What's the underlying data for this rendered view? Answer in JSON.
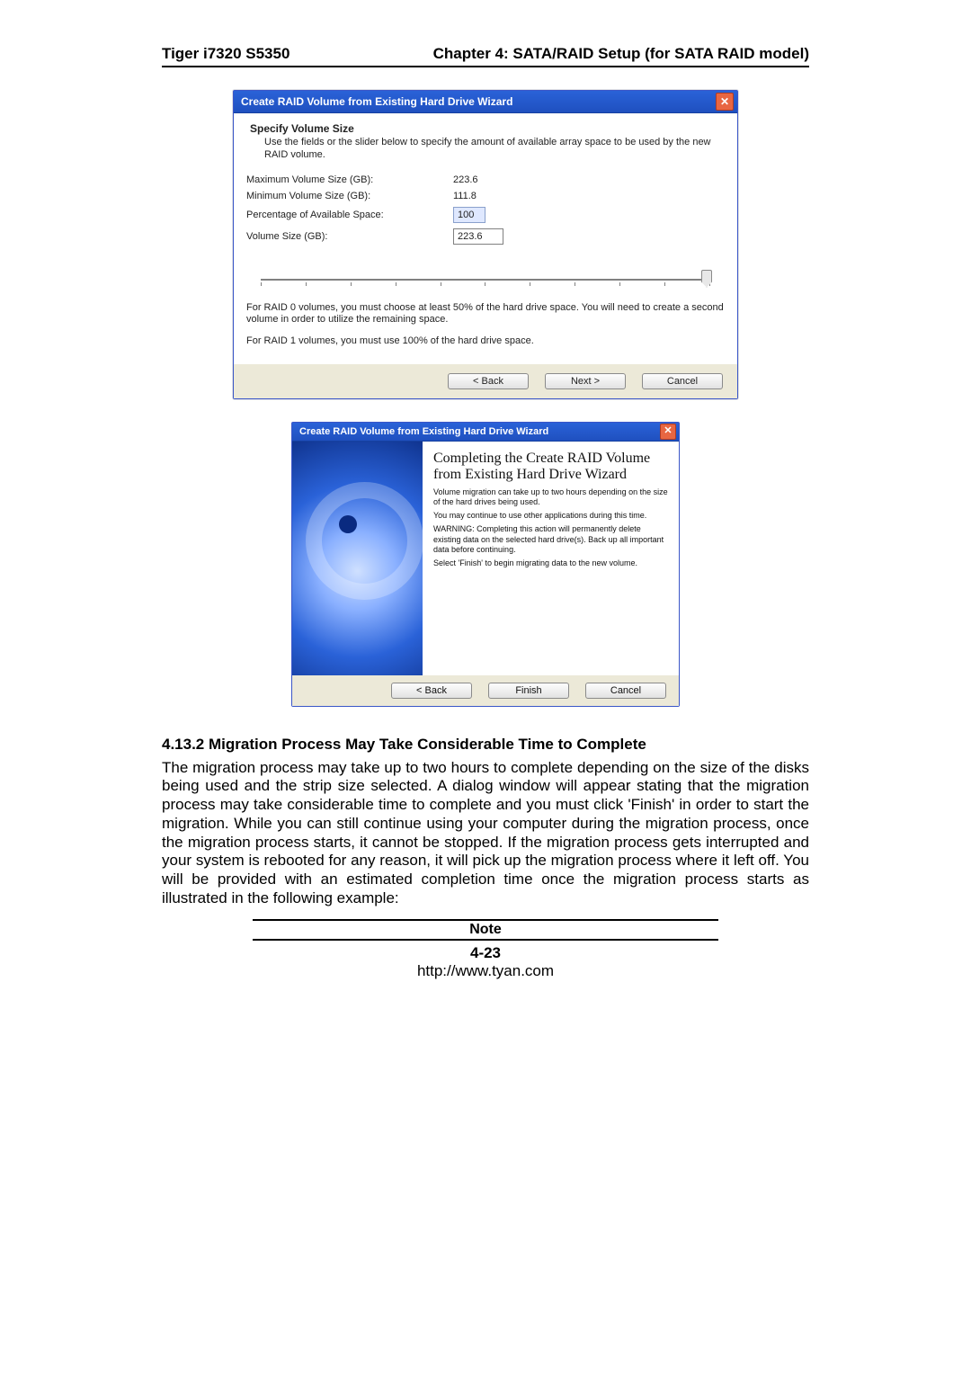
{
  "header": {
    "left": "Tiger i7320 S5350",
    "right": "Chapter 4: SATA/RAID Setup (for SATA RAID model)"
  },
  "dialog1": {
    "title": "Create RAID Volume from Existing Hard Drive Wizard",
    "subheader": "Specify Volume Size",
    "subdesc": "Use the fields or the slider below to specify the amount of available array space to be used by the new RAID volume.",
    "rows": {
      "maxLabel": "Maximum Volume Size (GB):",
      "maxValue": "223.6",
      "minLabel": "Minimum Volume Size (GB):",
      "minValue": "111.8",
      "pctLabel": "Percentage of Available Space:",
      "pctValue": "100",
      "sizeLabel": "Volume Size (GB):",
      "sizeValue": "223.6"
    },
    "note1": "For RAID 0 volumes, you must choose at least 50% of the hard drive space. You will need to create a second volume in order to utilize the remaining space.",
    "note2": "For RAID 1 volumes, you must use 100% of the hard drive space.",
    "buttons": {
      "back": "< Back",
      "next": "Next >",
      "cancel": "Cancel"
    }
  },
  "dialog2": {
    "title": "Create RAID Volume from Existing Hard Drive Wizard",
    "heading": "Completing the Create RAID Volume from Existing Hard Drive Wizard",
    "p1": "Volume migration can take up to two hours depending on the size of the hard drives being used.",
    "p2": "You may continue to use other applications during this time.",
    "p3": "WARNING: Completing this action will permanently delete existing data on the selected hard drive(s). Back up all important data before continuing.",
    "p4": "Select 'Finish' to begin migrating data to the new volume.",
    "buttons": {
      "back": "< Back",
      "finish": "Finish",
      "cancel": "Cancel"
    }
  },
  "section": {
    "heading": "4.13.2 Migration Process May Take Considerable Time to Complete",
    "paragraph": "The migration process may take up to two hours to complete depending on the size of the disks being used and the strip size selected. A dialog window will appear stating that the migration process may take considerable time to complete and you must click 'Finish' in order to start the migration. While you can still continue using your computer during the migration process, once the migration process starts, it cannot be stopped. If the migration process gets interrupted and your system is rebooted for any reason, it will pick up the migration process where it left off. You will be provided with an estimated completion time once the migration process starts as illustrated in the following example:"
  },
  "footer": {
    "note": "Note",
    "page": "4-23",
    "url": "http://www.tyan.com"
  }
}
